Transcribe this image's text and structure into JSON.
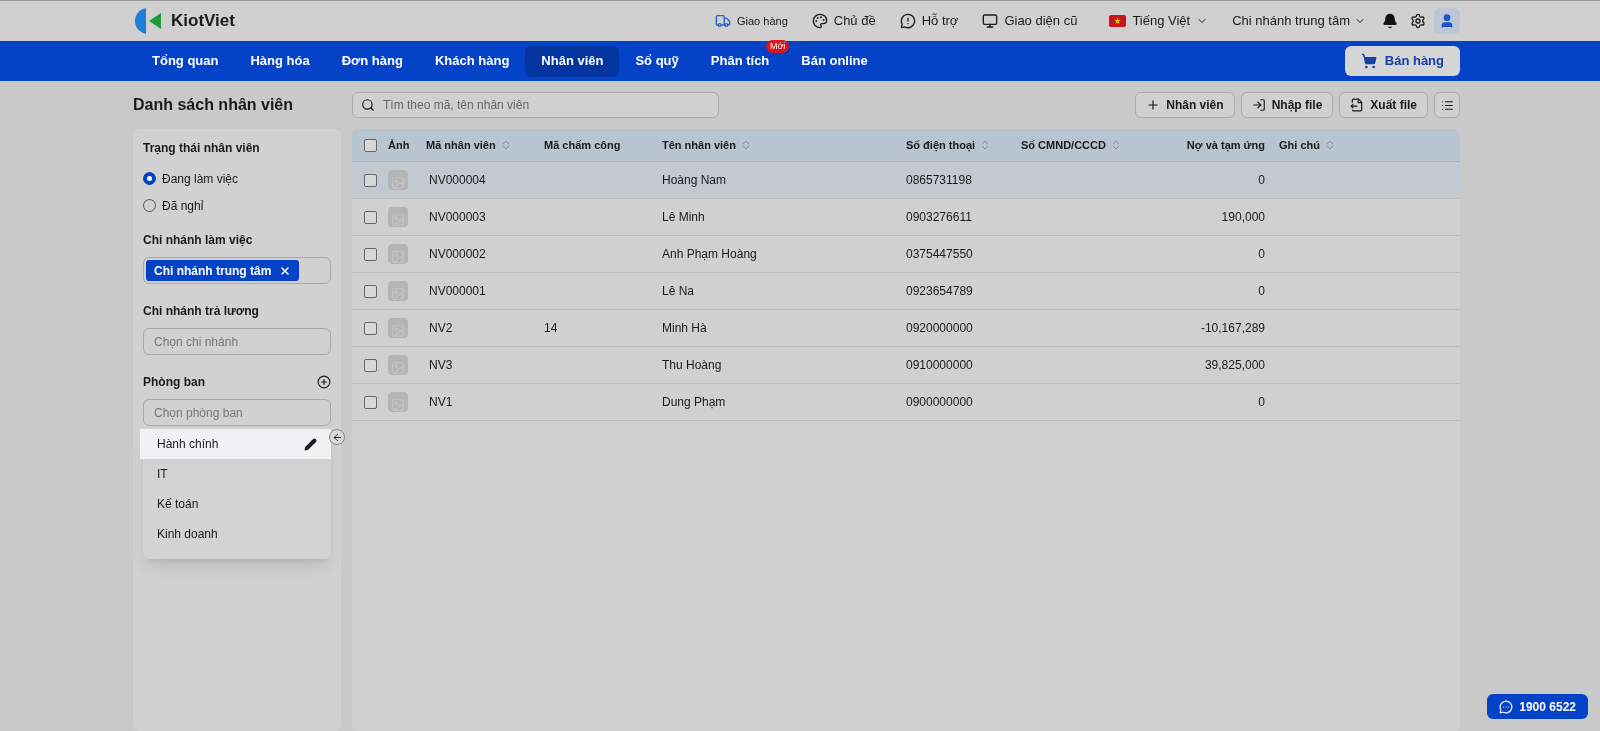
{
  "header": {
    "logo": "KiotViet",
    "links": [
      {
        "kind": "delivery",
        "label": "Giao hàng"
      },
      {
        "kind": "theme",
        "label": "Chủ đề"
      },
      {
        "kind": "support",
        "label": "Hỗ trợ"
      },
      {
        "kind": "monitor",
        "label": "Giao diện cũ"
      }
    ],
    "language": "Tiếng Việt",
    "branch": "Chi nhánh trung tâm"
  },
  "nav": {
    "tabs": [
      {
        "label": "Tổng quan",
        "selected": false
      },
      {
        "label": "Hàng hóa",
        "selected": false
      },
      {
        "label": "Đơn hàng",
        "selected": false
      },
      {
        "label": "Khách hàng",
        "selected": false
      },
      {
        "label": "Nhân viên",
        "selected": true
      },
      {
        "label": "Sổ quỹ",
        "selected": false
      },
      {
        "label": "Phân tích",
        "selected": false,
        "badge": "Mới"
      },
      {
        "label": "Bán online",
        "selected": false
      }
    ],
    "sell_button": "Bán hàng"
  },
  "page_title": "Danh sách nhân viên",
  "search": {
    "placeholder": "Tìm theo mã, tên nhân viên"
  },
  "actions": [
    {
      "kind": "add",
      "label": "Nhân viên"
    },
    {
      "kind": "import",
      "label": "Nhập file"
    },
    {
      "kind": "export",
      "label": "Xuất file"
    }
  ],
  "filters": {
    "status": {
      "title": "Trạng thái nhân viên",
      "options": [
        {
          "label": "Đang làm việc",
          "selected": true
        },
        {
          "label": "Đã nghỉ",
          "selected": false
        }
      ]
    },
    "work_branch": {
      "title": "Chi nhánh làm việc",
      "tags": [
        "Chi nhánh trung tâm"
      ]
    },
    "pay_branch": {
      "title": "Chi nhánh trả lương",
      "placeholder": "Chọn chi nhánh"
    },
    "department": {
      "title": "Phòng ban",
      "placeholder": "Chọn phòng ban",
      "options": [
        {
          "label": "Hành chính",
          "highlighted": true
        },
        {
          "label": "IT",
          "highlighted": false
        },
        {
          "label": "Kế toán",
          "highlighted": false
        },
        {
          "label": "Kinh doanh",
          "highlighted": false
        }
      ]
    }
  },
  "table": {
    "all_checked": false,
    "columns": [
      {
        "label": "Ảnh",
        "sortable": false
      },
      {
        "label": "Mã nhân viên",
        "sortable": true
      },
      {
        "label": "Mã chấm công",
        "sortable": false
      },
      {
        "label": "Tên nhân viên",
        "sortable": true
      },
      {
        "label": "Số điện thoại",
        "sortable": true
      },
      {
        "label": "Số CMND/CCCD",
        "sortable": true
      },
      {
        "label": "Nợ và tạm ứng",
        "sortable": false
      },
      {
        "label": "Ghi chú",
        "sortable": true
      }
    ],
    "rows": [
      {
        "checked": false,
        "highlighted": true,
        "code": "NV000004",
        "timekeeping": "",
        "name": "Hoàng Nam",
        "phone": "0865731198",
        "debt": "0"
      },
      {
        "checked": false,
        "highlighted": false,
        "code": "NV000003",
        "timekeeping": "",
        "name": "Lê Minh",
        "phone": "0903276611",
        "debt": "190,000"
      },
      {
        "checked": false,
        "highlighted": false,
        "code": "NV000002",
        "timekeeping": "",
        "name": "Anh Phạm Hoàng",
        "phone": "0375447550",
        "debt": "0"
      },
      {
        "checked": false,
        "highlighted": false,
        "code": "NV000001",
        "timekeeping": "",
        "name": "Lê Na",
        "phone": "0923654789",
        "debt": "0"
      },
      {
        "checked": false,
        "highlighted": false,
        "code": "NV2",
        "timekeeping": "14",
        "name": "Minh Hà",
        "phone": "0920000000",
        "debt": "-10,167,289"
      },
      {
        "checked": false,
        "highlighted": false,
        "code": "NV3",
        "timekeeping": "",
        "name": "Thu Hoàng",
        "phone": "0910000000",
        "debt": "39,825,000"
      },
      {
        "checked": false,
        "highlighted": false,
        "code": "NV1",
        "timekeeping": "",
        "name": "Dung Phạm",
        "phone": "0900000000",
        "debt": "0"
      }
    ]
  },
  "hotline": "1900 6522"
}
